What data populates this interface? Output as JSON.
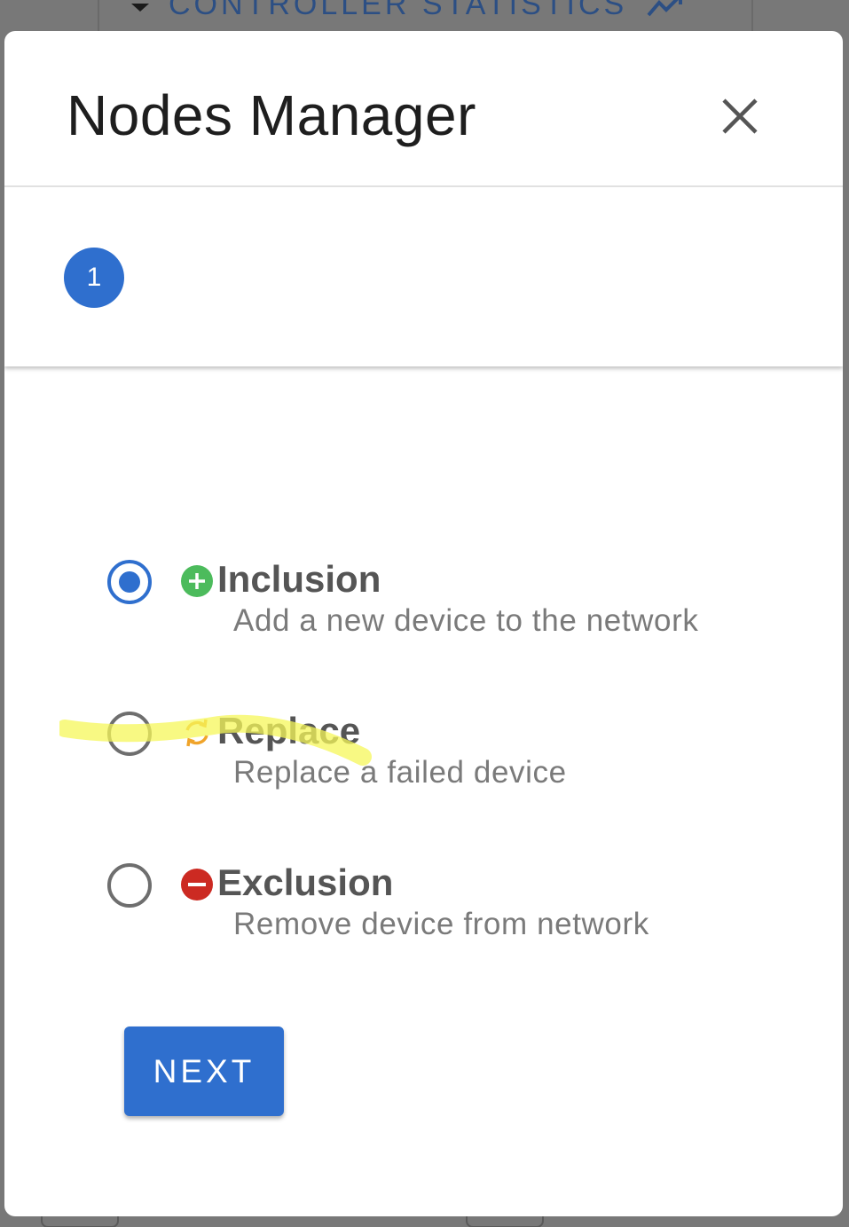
{
  "background": {
    "section_title": "CONTROLLER STATISTICS",
    "section_icon": "trending-up-icon"
  },
  "dialog": {
    "title": "Nodes Manager",
    "close_icon": "close-icon"
  },
  "stepper": {
    "active_step": "1"
  },
  "options": [
    {
      "title": "Inclusion",
      "description": "Add a new device to the network",
      "icon": "plus-circle-icon",
      "icon_color": "#4cbb5c",
      "selected": true
    },
    {
      "title": "Replace",
      "description": "Replace a failed device",
      "icon": "refresh-icon",
      "icon_color": "#f0a42a",
      "selected": false
    },
    {
      "title": "Exclusion",
      "description": "Remove device from network",
      "icon": "minus-circle-icon",
      "icon_color": "#cc2a22",
      "selected": false
    }
  ],
  "actions": {
    "next_label": "NEXT"
  },
  "colors": {
    "primary": "#2f6fce",
    "highlight": "#f5f75a"
  }
}
